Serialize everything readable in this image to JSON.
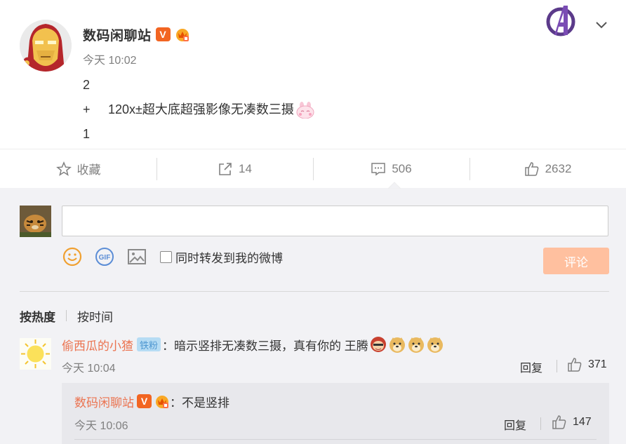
{
  "post": {
    "author": "数码闲聊站",
    "verified_badge": "V",
    "time": "今天 10:02",
    "lines": [
      {
        "prefix": "",
        "text": "2"
      },
      {
        "prefix": "+",
        "text": "120x±超大底超强影像无凑数三摄"
      },
      {
        "prefix": "",
        "text": "1"
      }
    ],
    "icons": [
      "ironman-avatar",
      "vip-crown-icon",
      "bunny-emoji",
      "avengers-logo",
      "chevron-down-icon"
    ]
  },
  "actions": {
    "favorite": "收藏",
    "repost_count": "14",
    "comment_count": "506",
    "like_count": "2632"
  },
  "composer": {
    "placeholder": "",
    "repost_label": "同时转发到我的微博",
    "submit_label": "评论",
    "icons": [
      "emoji-icon",
      "gif-icon",
      "image-icon"
    ]
  },
  "sort": {
    "hot": "按热度",
    "time": "按时间"
  },
  "comments": [
    {
      "user": "偷西瓜的小猹",
      "fan_badge": "铁粉",
      "separator": "：",
      "text": "暗示竖排无凑数三摄，真有你的 王腾",
      "time": "今天 10:04",
      "reply_label": "回复",
      "likes": "371",
      "replies": [
        {
          "user": "数码闲聊站",
          "verified_badge": "V",
          "separator": "：",
          "text": "不是竖排",
          "time": "今天 10:06",
          "reply_label": "回复",
          "likes": "147"
        }
      ]
    }
  ],
  "colors": {
    "username": "#eb7350",
    "submit_button": "#ffc09f",
    "panel_bg": "#f2f2f5",
    "reply_bg": "#e8e8ec",
    "verified": "#f26522"
  }
}
